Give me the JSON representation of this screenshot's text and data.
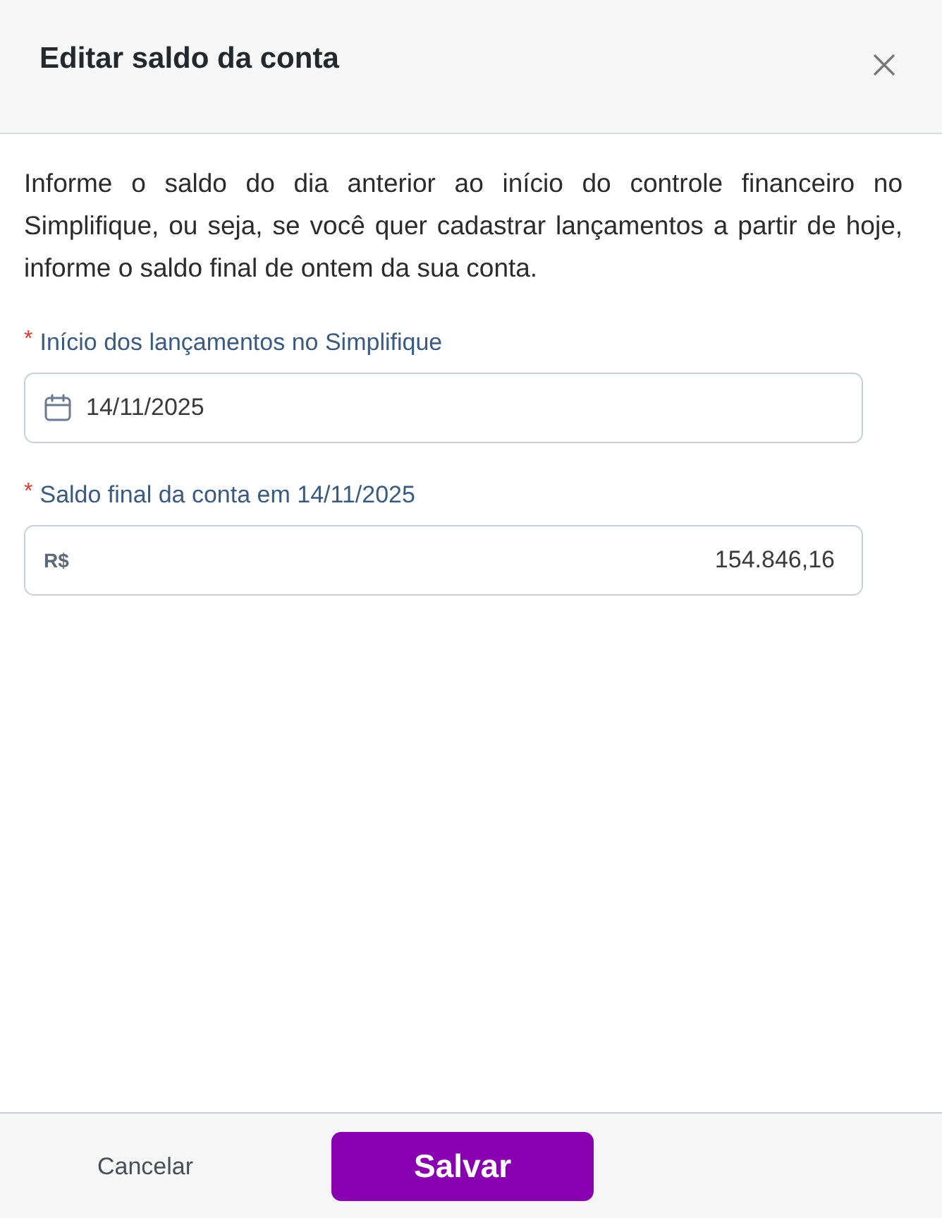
{
  "dialog": {
    "title": "Editar saldo da conta"
  },
  "description": "Informe o saldo do dia anterior ao início do controle financeiro no Simplifique, ou seja, se você quer cadastrar lançamentos a partir de hoje, informe o saldo final de ontem da sua conta.",
  "fields": [
    {
      "kind": "date",
      "required_mark": "*",
      "label": "Início dos lançamentos no Simplifique",
      "value": "14/11/2025"
    },
    {
      "kind": "currency",
      "required_mark": "*",
      "label": "Saldo final da conta em 14/11/2025",
      "prefix": "R$",
      "value": "154.846,16"
    }
  ],
  "buttons": [
    {
      "kind": "secondary",
      "label": "Cancelar"
    },
    {
      "kind": "primary",
      "label": "Salvar"
    }
  ]
}
